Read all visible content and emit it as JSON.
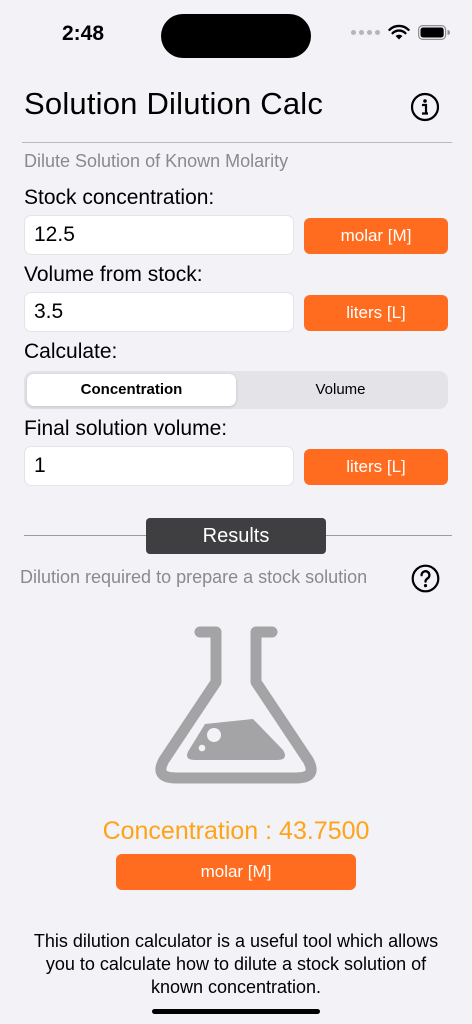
{
  "status_bar": {
    "time": "2:48"
  },
  "header": {
    "title": "Solution Dilution Calc"
  },
  "section": {
    "title": "Dilute Solution of Known Molarity"
  },
  "form": {
    "stock_concentration": {
      "label": "Stock concentration:",
      "value": "12.5",
      "unit": "molar [M]"
    },
    "volume_from_stock": {
      "label": "Volume from stock:",
      "value": "3.5",
      "unit": "liters [L]"
    },
    "calculate": {
      "label": "Calculate:",
      "options": [
        "Concentration",
        "Volume"
      ],
      "selected": "Concentration"
    },
    "final_volume": {
      "label": "Final solution volume:",
      "value": "1",
      "unit": "liters [L]"
    }
  },
  "results": {
    "tab_label": "Results",
    "subtitle": "Dilution required to prepare a stock solution",
    "value_text": "Concentration : 43.7500",
    "unit": "molar [M]"
  },
  "footer": {
    "text": "This dilution calculator is a useful tool which allows you to calculate how to dilute a stock solution of known concentration."
  },
  "colors": {
    "accent": "#ff6b1f",
    "result": "#ffa318",
    "flask": "#a4a4a6"
  }
}
